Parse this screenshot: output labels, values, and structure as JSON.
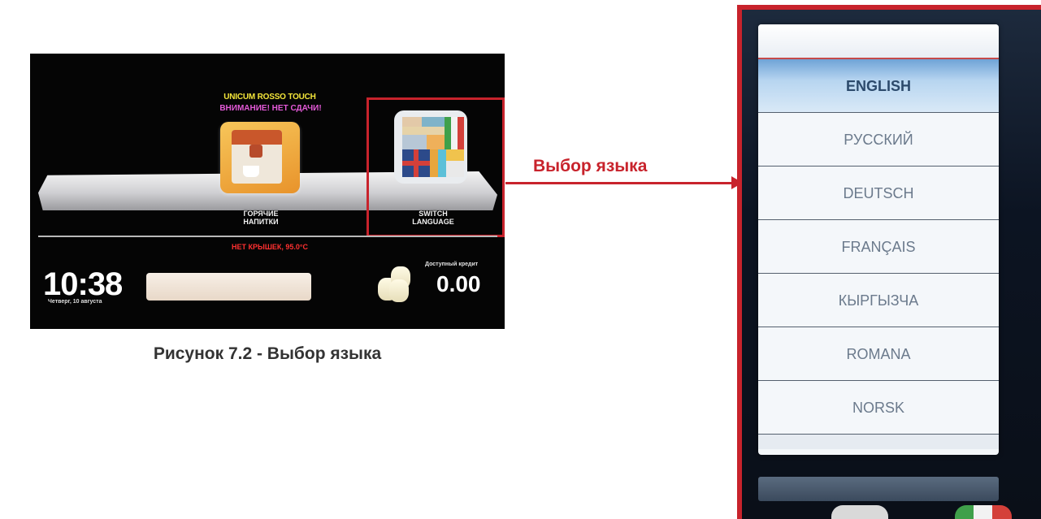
{
  "machine": {
    "brand": "UNICUM ROSSO TOUCH",
    "warning": "ВНИМАНИЕ! НЕТ СДАЧИ!",
    "hot_drinks_label_line1": "ГОРЯЧИЕ",
    "hot_drinks_label_line2": "НАПИТКИ",
    "switch_label_line1": "SWITCH",
    "switch_label_line2": "LANGUAGE",
    "status": "НЕТ КРЫШЕК, 95.0°C",
    "time": "10:38",
    "date": "Четверг, 10 августа",
    "credit_label": "Доступный кредит",
    "credit_value": "0.00"
  },
  "caption": "Рисунок 7.2 - Выбор языка",
  "arrow_label": "Выбор языка",
  "languages": {
    "selected_index": 0,
    "items": [
      "ENGLISH",
      "РУССКИЙ",
      "DEUTSCH",
      "FRANÇAIS",
      "КЫРГЫЗЧА",
      "ROMANA",
      "NORSK"
    ]
  },
  "colors": {
    "highlight": "#c8232c",
    "brand_text": "#f4e63a",
    "warning_text": "#e45ad8",
    "status_text": "#ff3030",
    "selected_item": "#b7d5f0"
  },
  "icons": {
    "hot_drinks": "coffee-machine-icon",
    "switch_language": "flags-icon",
    "credit": "coins-icon"
  }
}
